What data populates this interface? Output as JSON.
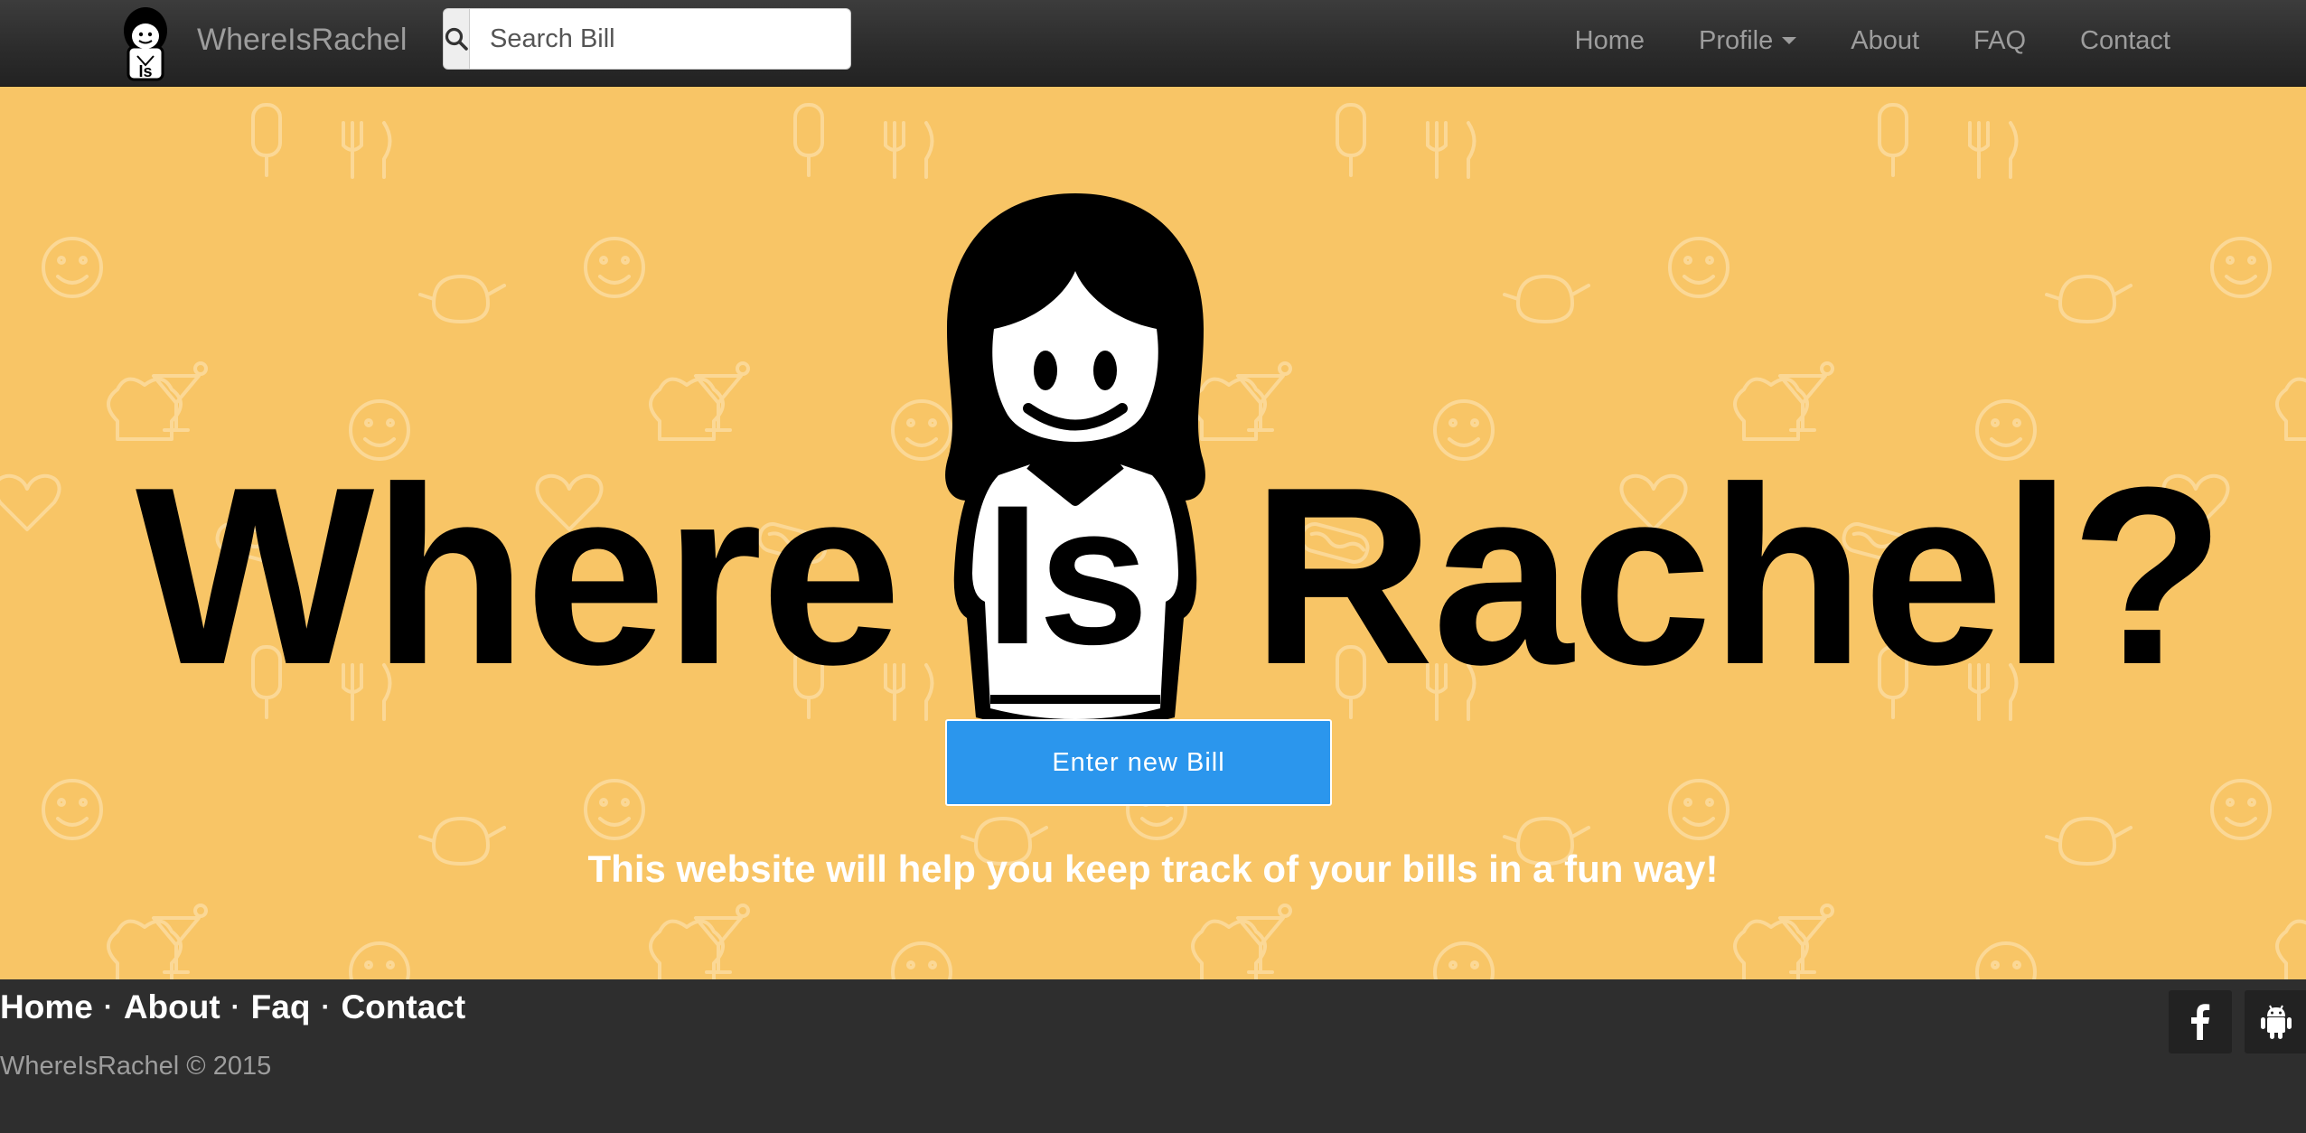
{
  "navbar": {
    "brand": "WhereIsRachel",
    "search": {
      "placeholder": "Search Bill",
      "value": ""
    },
    "links": [
      {
        "label": "Home"
      },
      {
        "label": "Profile",
        "has_dropdown": true
      },
      {
        "label": "About"
      },
      {
        "label": "FAQ"
      },
      {
        "label": "Contact"
      }
    ]
  },
  "hero": {
    "title_left": "Where",
    "title_mascot": "Is",
    "title_right": "Rachel?",
    "button_label": "Enter new Bill",
    "tagline": "This website will help you keep track of your bills in a fun way!",
    "background_color": "#f8c566",
    "button_color": "#2b96ed"
  },
  "footer": {
    "links": [
      "Home",
      "About",
      "Faq",
      "Contact"
    ],
    "separator": "·",
    "copyright": "WhereIsRachel © 2015",
    "social_icons": [
      "facebook-icon",
      "android-icon"
    ]
  }
}
